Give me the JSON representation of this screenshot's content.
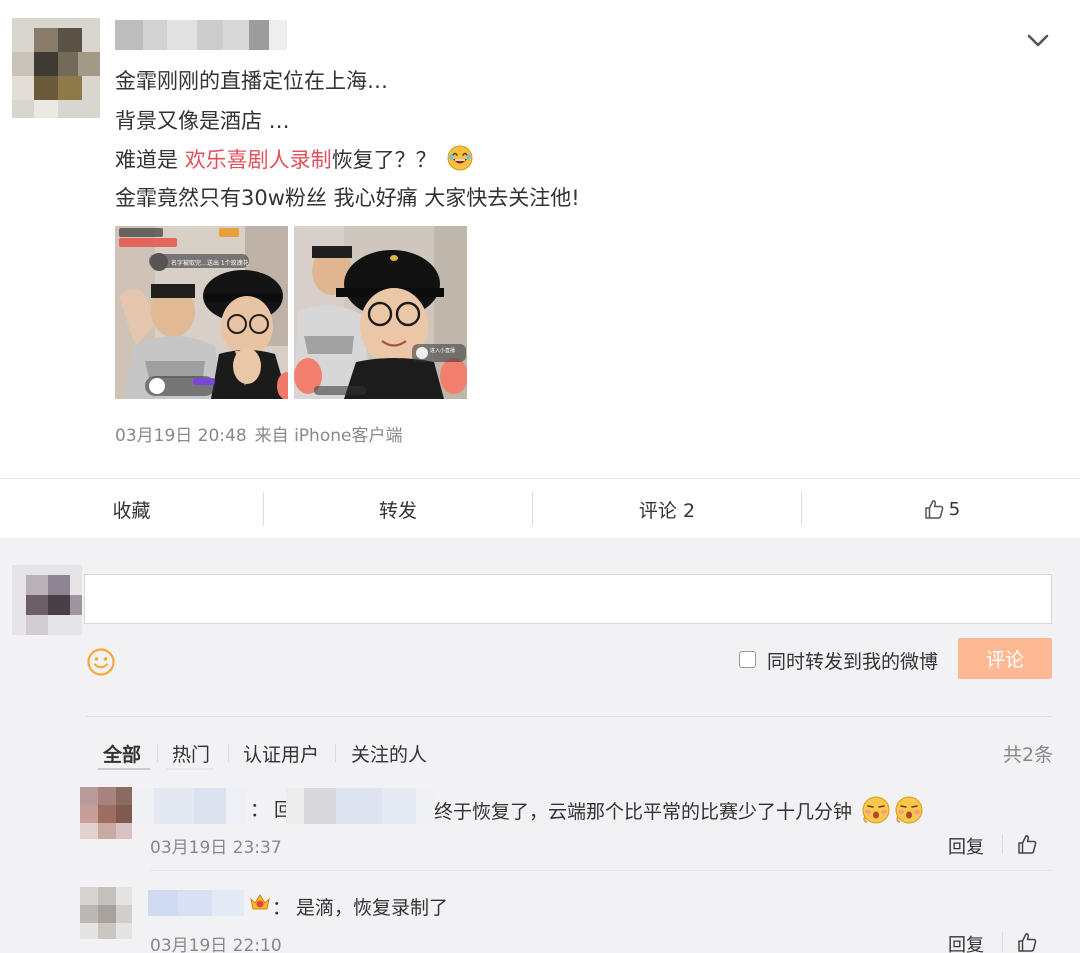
{
  "post": {
    "lines": [
      "金霏刚刚的直播定位在上海…",
      "背景又像是酒店 …",
      "难道是 ",
      "欢乐喜剧人录制",
      "恢复了？？",
      "金霏竟然只有30w粉丝 我心好痛 大家快去关注他!"
    ],
    "time": "03月19日 20:48",
    "source": "来自 iPhone客户端",
    "image_1_overlay": "名字被取完…送出 1个玫瑰花",
    "image_2_overlay": "进入小直播"
  },
  "actions": {
    "favorite": "收藏",
    "repost": "转发",
    "comment": "评论 2",
    "like_count": "5"
  },
  "composer": {
    "input_value": "",
    "repost_checkbox_label": "同时转发到我的微博",
    "submit": "评论"
  },
  "comments_header": {
    "filters": [
      "全部",
      "热门",
      "认证用户",
      "关注的人"
    ],
    "total": "共2条"
  },
  "comments": [
    {
      "colon": "：",
      "prefix": "回",
      "text": "终于恢复了，云端那个比平常的比赛少了十几分钟",
      "time": "03月19日 23:37",
      "reply": "回复"
    },
    {
      "colon": "：",
      "text": "是滴，恢复录制了",
      "time": "03月19日 22:10",
      "reply": "回复"
    }
  ],
  "colors": {
    "accent_orange": "#fdb994",
    "topic_red": "#e2505a",
    "emoji_yellow": "#f7a93b"
  }
}
